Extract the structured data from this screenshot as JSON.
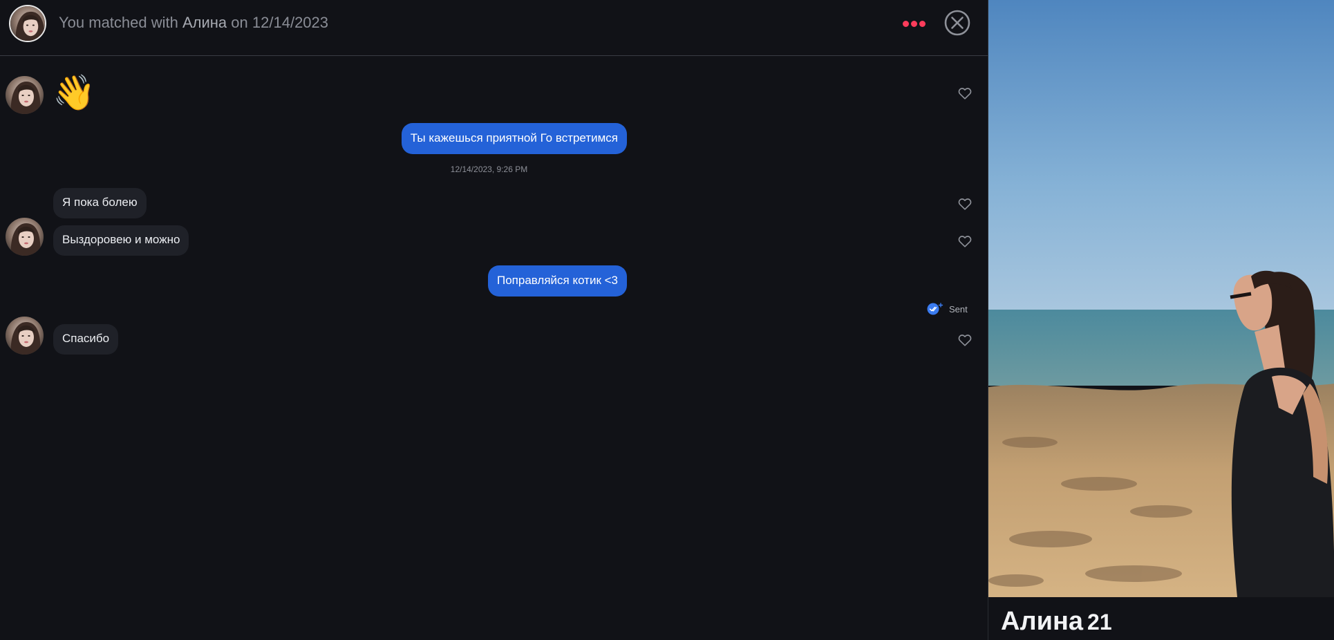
{
  "header": {
    "title_prefix": "You matched with",
    "match_name": "Алина",
    "title_middle": "on",
    "match_date": "12/14/2023",
    "more_icon": "more-dots-icon",
    "close_icon": "close-circle-icon"
  },
  "messages": {
    "wave_emoji": "👋",
    "out_1": "Ты кажешься приятной Го встретимся",
    "timestamp": "12/14/2023, 9:26 PM",
    "in_1": "Я пока болею",
    "in_2": "Выздоровею и можно",
    "out_2": "Поправляйся котик <3",
    "sent_status": "Sent",
    "in_3": "Спасибо"
  },
  "profile": {
    "name": "Алина",
    "age": "21"
  },
  "colors": {
    "accent": "#fe3c5b",
    "outgoing_bubble": "#2462d8",
    "incoming_bubble": "#1f2128",
    "background": "#111217"
  }
}
